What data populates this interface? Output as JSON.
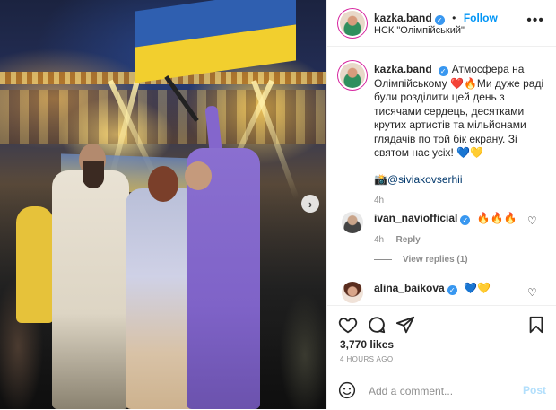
{
  "header": {
    "username": "kazka.band",
    "follow_label": "Follow",
    "separator": "•",
    "location": "НСК \"Олімпійський\"",
    "more_icon": "more-dots-icon"
  },
  "caption": {
    "username": "kazka.band",
    "text": "Атмосфера на Олімпійському ❤️🔥Ми дуже раді були розділити цей день з тисячами сердець, десятками крутих артистів та мільйонами глядачів по той бік екрану. Зі святом нас усіх! 💙💛",
    "credit_prefix": "📸",
    "credit_mention": "@siviakovserhii",
    "time": "4h"
  },
  "comments": [
    {
      "username": "ivan_naviofficial",
      "text": "🔥🔥🔥",
      "time": "4h",
      "reply_label": "Reply",
      "view_replies": "View replies (1)"
    },
    {
      "username": "alina_baikova",
      "text": "💙💛"
    }
  ],
  "actions": {
    "like_icon": "heart-icon",
    "comment_icon": "comment-icon",
    "share_icon": "paper-plane-icon",
    "save_icon": "bookmark-icon",
    "likes": "3,770 likes",
    "posted": "4 HOURS AGO"
  },
  "add_comment": {
    "emoji_icon": "smiley-icon",
    "placeholder": "Add a comment...",
    "post_label": "Post"
  },
  "colors": {
    "link": "#0095f6",
    "verified": "#3897f0",
    "muted": "#8e8e8e",
    "post_disabled": "#b2dffc"
  }
}
